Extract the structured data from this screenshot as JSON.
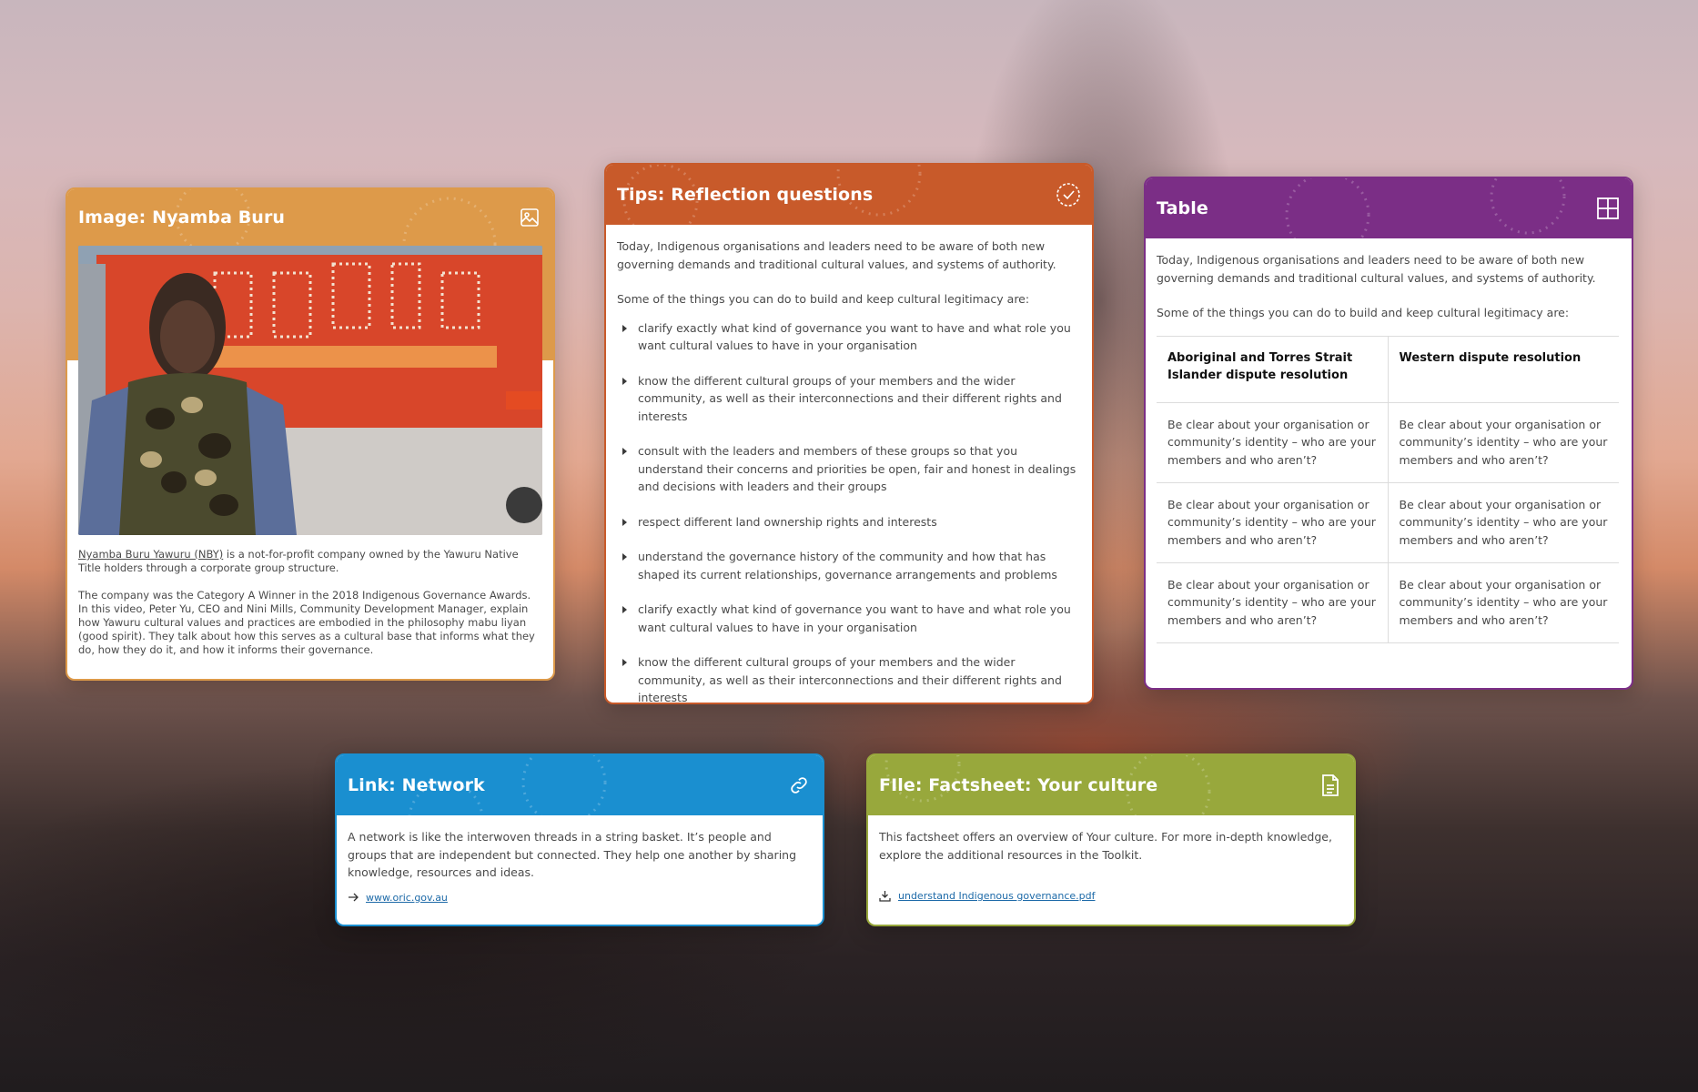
{
  "image_card": {
    "title": "Image: Nyamba Buru",
    "icon": "image-icon",
    "caption_link": "Nyamba Buru Yawuru (NBY)",
    "caption_rest": " is a not-for-profit company owned by the Yawuru Native Title holders through a corporate group structure.",
    "paragraph": "The company was the Category A Winner in the 2018 Indigenous Governance Awards. In this video, Peter Yu, CEO and Nini Mills, Community Development Manager, explain how Yawuru cultural values and practices are embodied in the philosophy mabu liyan (good spirit). They talk about how this serves as a cultural base that informs what they do, how they do it, and how it informs their governance."
  },
  "tips_card": {
    "title": "Tips: Reflection questions",
    "icon": "check-circle-icon",
    "intro": "Today, Indigenous organisations and leaders need to be aware of both new governing demands and traditional cultural values, and systems of authority.",
    "lead": "Some of the things you can do to build and keep cultural legitimacy are:",
    "items": [
      "clarify exactly what kind of governance you want to have and what role you want cultural values to have in your organisation",
      "know the different cultural groups of your members and the wider community, as well as their interconnections and their different rights and interests",
      "consult with the leaders and members of these groups so that you understand their concerns and priorities be open, fair and honest in dealings and decisions with leaders and their groups",
      "respect different land ownership rights and interests",
      "understand the governance history of the community and how that has shaped its current relationships, governance arrangements and problems",
      "clarify exactly what kind of governance you want to have and what role you want cultural values to have in your organisation",
      "know the different cultural groups of your members and the wider community, as well as their interconnections and their different rights and interests"
    ]
  },
  "table_card": {
    "title": "Table",
    "icon": "grid-icon",
    "intro": "Today, Indigenous organisations and leaders need to be aware of both new governing demands and traditional cultural values, and systems of authority.",
    "lead": "Some of the things you can do to build and keep cultural legitimacy are:",
    "headers": [
      "Aboriginal and Torres Strait Islander dispute resolution",
      "Western dispute resolution"
    ],
    "rows": [
      [
        "Be clear about your organisation or community’s identity – who are your members and who aren’t?",
        "Be clear about your organisation or community’s identity – who are your members and who aren’t?"
      ],
      [
        "Be clear about your organisation or community’s identity – who are your members and who aren’t?",
        "Be clear about your organisation or community’s identity – who are your members and who aren’t?"
      ],
      [
        "Be clear about your organisation or community’s identity – who are your members and who aren’t?",
        "Be clear about your organisation or community’s identity – who are your members and who aren’t?"
      ]
    ]
  },
  "link_card": {
    "title": "Link: Network",
    "icon": "link-icon",
    "text": "A network is like the interwoven threads in a string basket. It’s people and groups that are independent but connected. They help one another by sharing knowledge, resources and ideas.",
    "link": "www.oric.gov.au",
    "link_icon": "arrow-right-icon"
  },
  "file_card": {
    "title": "FIle: Factsheet: Your culture",
    "icon": "document-icon",
    "text": "This factsheet offers an overview of Your culture. For more in-depth knowledge, explore the additional resources in the Toolkit.",
    "link": "understand Indigenous governance.pdf",
    "link_icon": "download-icon"
  },
  "colors": {
    "image_accent": "#dd9a4a",
    "tips_accent": "#c85a2a",
    "table_accent": "#7b2e86",
    "link_accent": "#1a8fd0",
    "file_accent": "#98a83c"
  }
}
